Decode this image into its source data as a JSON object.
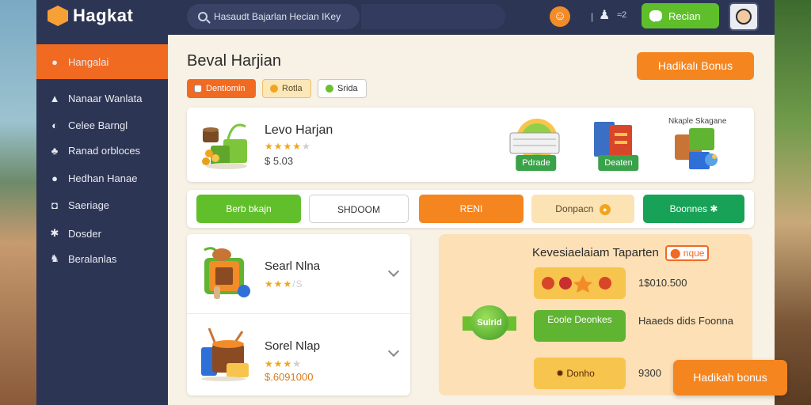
{
  "brand": {
    "name": "Hagkat",
    "accent": "#f06a22",
    "nav_bg": "#2d3554"
  },
  "search": {
    "placeholder": "Hasaudt Bajarlan Hecian IKey"
  },
  "topbar": {
    "separator": "|",
    "count": "≈2",
    "chat_label": "Recian"
  },
  "sidebar": {
    "items": [
      {
        "label": "Hangalai",
        "icon": "user-icon",
        "active": true
      },
      {
        "label": "Nanaar Wanlata",
        "icon": "cart-icon"
      },
      {
        "label": "Celee Barngl",
        "icon": "chat-icon"
      },
      {
        "label": "Ranad orbloces",
        "icon": "people-icon"
      },
      {
        "label": "Hedhan Hanae",
        "icon": "user-icon"
      },
      {
        "label": "Saeriage",
        "icon": "bag-icon"
      },
      {
        "label": "Dosder",
        "icon": "settings-icon"
      },
      {
        "label": "Beralanlas",
        "icon": "paw-icon"
      }
    ]
  },
  "main": {
    "title": "Beval Harjian",
    "hero_button": "Hadikalı Bonus",
    "chips": [
      "Dentiomin",
      "Rotla",
      "Srida"
    ]
  },
  "featured": {
    "title": "Levo Harjan",
    "rating": 4,
    "price": "$ 5.03",
    "tiles": [
      "Pdrade",
      "Deaten",
      ""
    ],
    "tile_label": "Nkaple Skagane"
  },
  "action_buttons": [
    "Berb bkajn",
    "SHDOOM",
    "RENI",
    "Donpacn",
    "Boonnes"
  ],
  "list": [
    {
      "title": "Searl Nlna",
      "rating": 3,
      "meta": "/S",
      "price": ""
    },
    {
      "title": "Sorel Nlap",
      "rating": 3,
      "meta": "",
      "price": "$.6091000"
    }
  ],
  "bonus": {
    "title": "Kevesiaelaiam Taparten",
    "tag": "nque",
    "ribbon": "Sulrid",
    "rewards": [
      {
        "label": "",
        "value": "1$010.500"
      },
      {
        "label": "Eoole Deonkes",
        "value": "Haaeds dids Foonna"
      },
      {
        "label": "Donho",
        "value": "9300"
      }
    ]
  },
  "floating_button": "Hadikah bonus"
}
